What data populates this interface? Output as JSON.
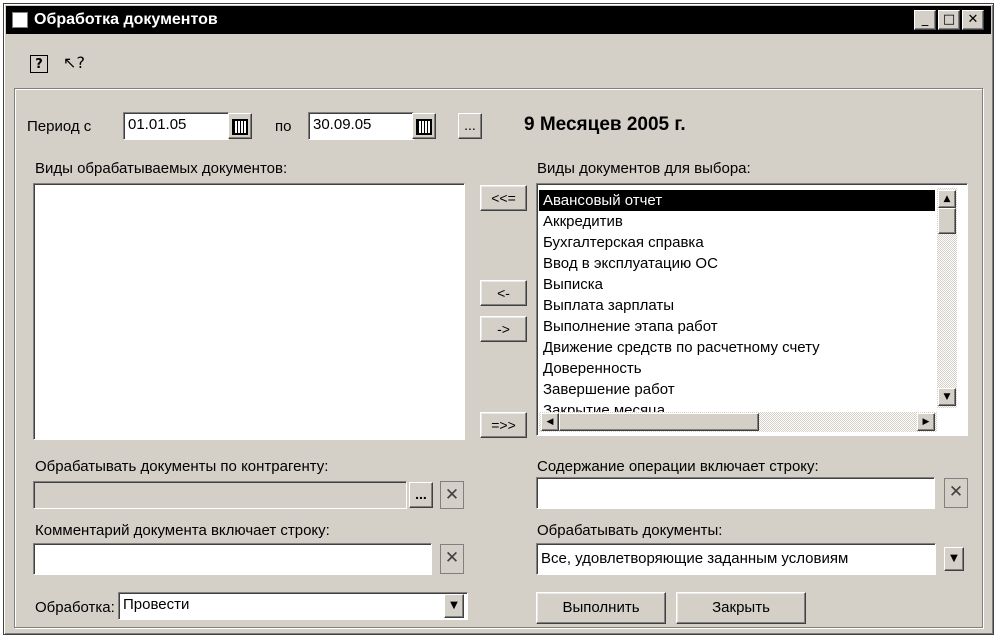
{
  "window": {
    "title": "Обработка документов",
    "controls": {
      "minimize": "_",
      "maximize": "□",
      "close": "✕"
    }
  },
  "toolbar": {
    "help_icon": "?",
    "context_help_icon": "↖?"
  },
  "period": {
    "from_label": "Период с",
    "from_value": "01.01.05",
    "to_label": "по",
    "to_value": "30.09.05",
    "ellipsis_label": "...",
    "summary": "9 Месяцев 2005 г."
  },
  "processed_docs": {
    "label": "Виды обрабатываемых документов:",
    "items": []
  },
  "transfer_buttons": {
    "move_all_left": "<<=",
    "move_left": "<-",
    "move_right": "->",
    "move_all_right": "=>>"
  },
  "available_docs": {
    "label": "Виды документов для выбора:",
    "items": [
      "Авансовый отчет",
      "Аккредитив",
      "Бухгалтерская справка",
      "Ввод в эксплуатацию ОС",
      "Выписка",
      "Выплата зарплаты",
      "Выполнение этапа работ",
      "Движение средств по расчетному счету",
      "Доверенность",
      "Завершение работ",
      "Закрытие месяца"
    ],
    "selected_index": 0
  },
  "contractor": {
    "label": "Обрабатывать документы по контрагенту:",
    "value": "",
    "select_label": "...",
    "clear_label": "✕"
  },
  "operation_content": {
    "label": "Содержание операции включает строку:",
    "value": "",
    "clear_label": "✕"
  },
  "comment": {
    "label": "Комментарий документа включает строку:",
    "value": "",
    "clear_label": "✕"
  },
  "process_docs": {
    "label": "Обрабатывать документы:",
    "value": "Все, удовлетворяющие заданным условиям"
  },
  "processing": {
    "label": "Обработка:",
    "value": "Провести"
  },
  "actions": {
    "run": "Выполнить",
    "close": "Закрыть"
  }
}
